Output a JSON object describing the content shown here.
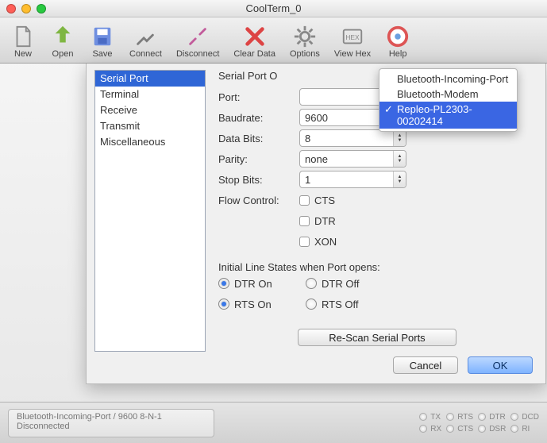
{
  "window_title": "CoolTerm_0",
  "toolbar": {
    "new": "New",
    "open": "Open",
    "save": "Save",
    "connect": "Connect",
    "disconnect": "Disconnect",
    "clear": "Clear Data",
    "options": "Options",
    "viewhex": "View Hex",
    "help": "Help"
  },
  "categories": {
    "items": [
      "Serial Port",
      "Terminal",
      "Receive",
      "Transmit",
      "Miscellaneous"
    ],
    "selected_index": 0
  },
  "panel": {
    "header": "Serial Port O",
    "labels": {
      "port": "Port:",
      "baud": "Baudrate:",
      "databits": "Data Bits:",
      "parity": "Parity:",
      "stopbits": "Stop Bits:",
      "flow": "Flow Control:",
      "initial": "Initial Line States when Port opens:"
    },
    "values": {
      "baud": "9600",
      "databits": "8",
      "parity": "none",
      "stopbits": "1"
    },
    "flow": {
      "cts": "CTS",
      "dtr": "DTR",
      "xon": "XON"
    },
    "radios": {
      "dtr_on": "DTR On",
      "dtr_off": "DTR Off",
      "rts_on": "RTS On",
      "rts_off": "RTS Off"
    },
    "rescan": "Re-Scan Serial Ports",
    "cancel": "Cancel",
    "ok": "OK"
  },
  "port_dropdown": {
    "options": [
      "Bluetooth-Incoming-Port",
      "Bluetooth-Modem",
      "Repleo-PL2303-00202414"
    ],
    "selected_index": 2
  },
  "status": {
    "line1": "Bluetooth-Incoming-Port / 9600 8-N-1",
    "line2": "Disconnected",
    "indicators": [
      "TX",
      "RX",
      "RTS",
      "CTS",
      "DTR",
      "DSR",
      "DCD",
      "RI"
    ]
  }
}
